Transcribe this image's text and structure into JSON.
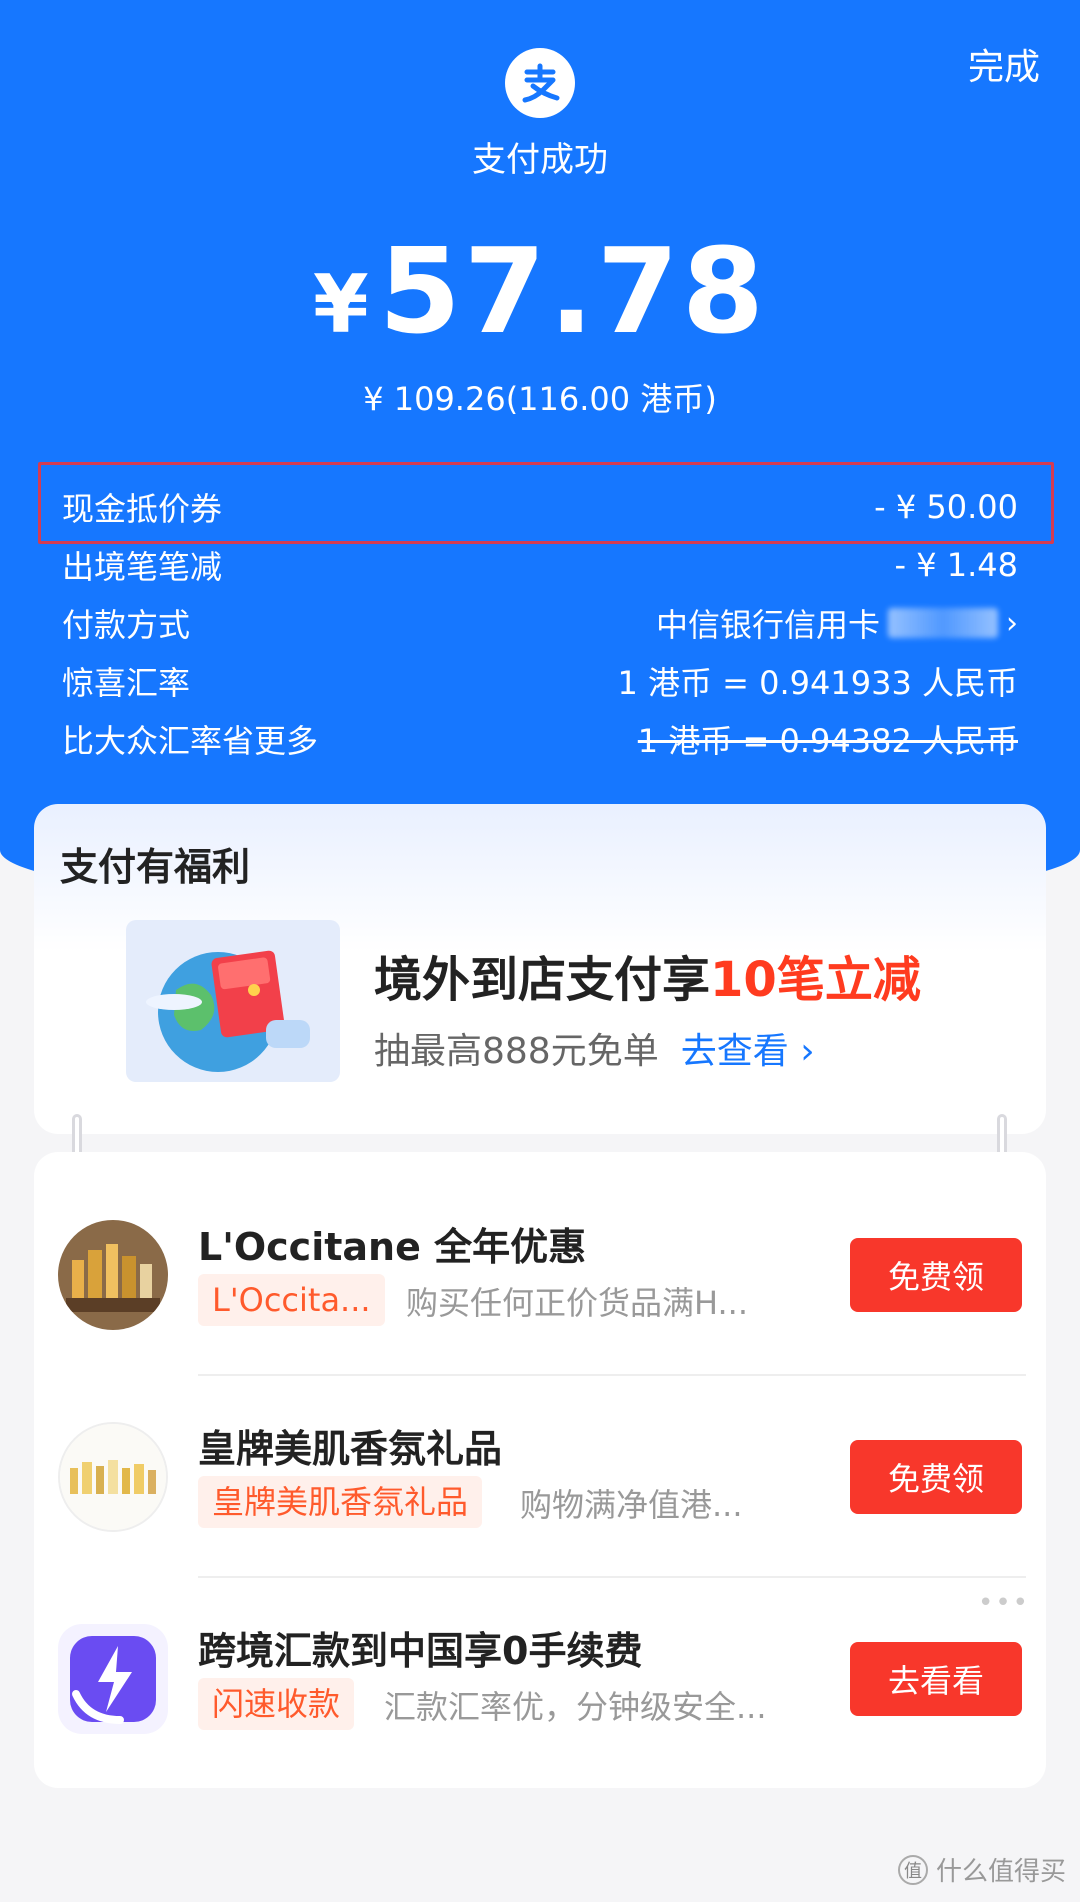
{
  "header": {
    "done_label": "完成",
    "logo_icon": "alipay-logo-icon",
    "status_text": "支付成功"
  },
  "payment": {
    "currency_symbol": "¥",
    "amount": "57.78",
    "original": "¥ 109.26(116.00 港币)"
  },
  "details": [
    {
      "label": "现金抵价券",
      "value": "- ¥ 50.00"
    },
    {
      "label": "出境笔笔减",
      "value": "- ¥ 1.48"
    },
    {
      "label": "付款方式",
      "value": "中信银行信用卡"
    },
    {
      "label": "惊喜汇率",
      "value": "1 港币 = 0.941933 人民币"
    },
    {
      "label": "比大众汇率省更多",
      "value": "1 港币 = 0.94382 人民币"
    }
  ],
  "benefits": {
    "heading": "支付有福利",
    "title_prefix": "境外到店支付享",
    "title_highlight": "10笔立减",
    "subtitle": "抽最高888元免单",
    "link_label": "去查看"
  },
  "offers": [
    {
      "title": "L'Occitane 全年优惠",
      "tag": "L'Occita...",
      "desc": "购买任何正价货品满H...",
      "button": "免费领"
    },
    {
      "title": "皇牌美肌香氛礼品",
      "tag": "皇牌美肌香氛礼品",
      "desc": "购物满净值港...",
      "button": "免费领"
    },
    {
      "title": "跨境汇款到中国享0手续费",
      "tag": "闪速收款",
      "desc": "汇款汇率优，分钟级安全...",
      "button": "去看看"
    }
  ],
  "watermark": "什么值得买",
  "colors": {
    "brand_blue": "#1677ff",
    "accent_red": "#f8372b",
    "highlight_box": "#d43c52"
  }
}
